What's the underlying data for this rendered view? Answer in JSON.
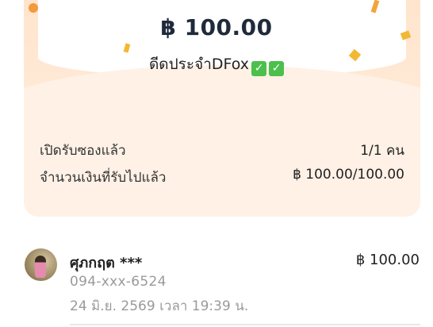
{
  "summary": {
    "amount": "฿ 100.00",
    "greeting": "ดีดประจำDFox",
    "check_icons": [
      "white-check-mark",
      "white-check-mark"
    ]
  },
  "details": {
    "opened_label": "เปิดรับซองแล้ว",
    "opened_value": "1/1 คน",
    "received_label": "จำนวนเงินที่รับไปแล้ว",
    "received_value": "฿ 100.00/100.00"
  },
  "recipients": [
    {
      "name": "ศุภกฤต ***",
      "phone": "094-xxx-6524",
      "time": "24 มิ.ย. 2569 เวลา 19:39 น.",
      "amount": "฿ 100.00"
    }
  ],
  "colors": {
    "card_bg": "#fff1e6",
    "confetti_orange": "#f39a3c",
    "confetti_yellow": "#f3b833",
    "check_green": "#4cbf4c"
  }
}
